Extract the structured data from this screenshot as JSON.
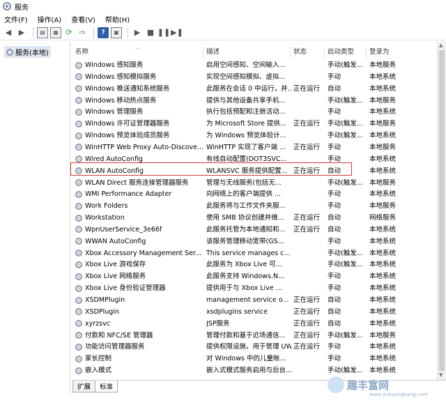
{
  "window": {
    "title": "服务"
  },
  "menu": [
    {
      "label": "文件(F)"
    },
    {
      "label": "操作(A)"
    },
    {
      "label": "查看(V)"
    },
    {
      "label": "帮助(H)"
    }
  ],
  "tree": {
    "item": "服务(本地)"
  },
  "columns": {
    "name": "名称",
    "desc": "描述",
    "status": "状态",
    "start": "启动类型",
    "logon": "登录为"
  },
  "services": [
    {
      "name": "Windows 感知服务",
      "desc": "启用空间感知、空间输入...",
      "status": "",
      "start": "手动(触发...",
      "logon": "本地服务"
    },
    {
      "name": "Windows 感知模拟服务",
      "desc": "实现空间感知模拟、虚拟...",
      "status": "",
      "start": "手动",
      "logon": "本地系统"
    },
    {
      "name": "Windows 推送通知系统服务",
      "desc": "此服务在会话 0 中运行，并...",
      "status": "正在运行",
      "start": "自动",
      "logon": "本地系统"
    },
    {
      "name": "Windows 移动热点服务",
      "desc": "提供与其他设备共享手机...",
      "status": "",
      "start": "手动(触发...",
      "logon": "本地服务"
    },
    {
      "name": "Windows 管理服务",
      "desc": "执行包括预配和注册活动...",
      "status": "",
      "start": "手动",
      "logon": "本地系统"
    },
    {
      "name": "Windows 许可证管理器服务",
      "desc": "为 Microsoft Store 提供...",
      "status": "正在运行",
      "start": "手动(触发...",
      "logon": "本地服务"
    },
    {
      "name": "Windows 预览体验成员服务",
      "desc": "为 Windows 预览体验计...",
      "status": "",
      "start": "手动(触发...",
      "logon": "本地系统"
    },
    {
      "name": "WinHTTP Web Proxy Auto-Discove...",
      "desc": "WinHTTP 实现了客户端 ...",
      "status": "正在运行",
      "start": "手动",
      "logon": "本地服务"
    },
    {
      "name": "Wired AutoConfig",
      "desc": "有线自动配置(DOT3SVC...",
      "status": "",
      "start": "手动",
      "logon": "本地系统"
    },
    {
      "name": "WLAN AutoConfig",
      "desc": "WLANSVC 服务提供配置...",
      "status": "正在运行",
      "start": "自动",
      "logon": "本地系统"
    },
    {
      "name": "WLAN Direct 服务连接管理器服务",
      "desc": "管理与无线服务(包括无...",
      "status": "",
      "start": "手动(触发...",
      "logon": "本地服务"
    },
    {
      "name": "WMI Performance Adapter",
      "desc": "向网络上的客户端提供 ...",
      "status": "",
      "start": "手动",
      "logon": "本地系统"
    },
    {
      "name": "Work Folders",
      "desc": "此服务将与工作文件夹服...",
      "status": "",
      "start": "手动",
      "logon": "本地服务"
    },
    {
      "name": "Workstation",
      "desc": "使用 SMB 协议创建并维...",
      "status": "正在运行",
      "start": "自动",
      "logon": "网络服务"
    },
    {
      "name": "WpnUserService_3e66f",
      "desc": "此服务托管为本地通知和...",
      "status": "正在运行",
      "start": "自动",
      "logon": "本地系统"
    },
    {
      "name": "WWAN AutoConfig",
      "desc": "该服务管理移动宽带(GS...",
      "status": "",
      "start": "手动",
      "logon": "本地系统"
    },
    {
      "name": "Xbox Accessory Management Ser...",
      "desc": "This service manages c...",
      "status": "",
      "start": "手动(触发...",
      "logon": "本地系统"
    },
    {
      "name": "Xbox Live 游戏保存",
      "desc": "此服务为 Xbox Live 可...",
      "status": "",
      "start": "手动(触发...",
      "logon": "本地系统"
    },
    {
      "name": "Xbox Live 网络服务",
      "desc": "此服务支持 Windows.N...",
      "status": "",
      "start": "手动",
      "logon": "本地系统"
    },
    {
      "name": "Xbox Live 身份验证管理器",
      "desc": "提供用于与 Xbox Live ...",
      "status": "",
      "start": "手动",
      "logon": "本地系统"
    },
    {
      "name": "XSDMPlugin",
      "desc": "management service o...",
      "status": "正在运行",
      "start": "自动",
      "logon": "本地系统"
    },
    {
      "name": "XSDPlugin",
      "desc": "xsdplugins service",
      "status": "正在运行",
      "start": "自动",
      "logon": "本地系统"
    },
    {
      "name": "xyrzsvc",
      "desc": "JSP服务",
      "status": "正在运行",
      "start": "自动",
      "logon": "本地系统"
    },
    {
      "name": "付款和 NFC/SE 管理器",
      "desc": "管理付款和基于近场通信...",
      "status": "正在运行",
      "start": "手动(触发...",
      "logon": "本地服务"
    },
    {
      "name": "功能访问管理器服务",
      "desc": "提供权限设施，用于管理 UW...",
      "status": "正在运行",
      "start": "手动",
      "logon": "本地系统"
    },
    {
      "name": "家长控制",
      "desc": "对 Windows 中的儿童帐...",
      "status": "",
      "start": "手动",
      "logon": "本地系统"
    },
    {
      "name": "嵌入模式",
      "desc": "嵌入式模式服务启用与后台...",
      "status": "",
      "start": "手动(触发...",
      "logon": "本地系统"
    }
  ],
  "tabs": [
    {
      "label": "扩展"
    },
    {
      "label": "标准"
    }
  ],
  "watermark": {
    "text": "趣丰富网",
    "url": "www.yueyangbang.com"
  }
}
